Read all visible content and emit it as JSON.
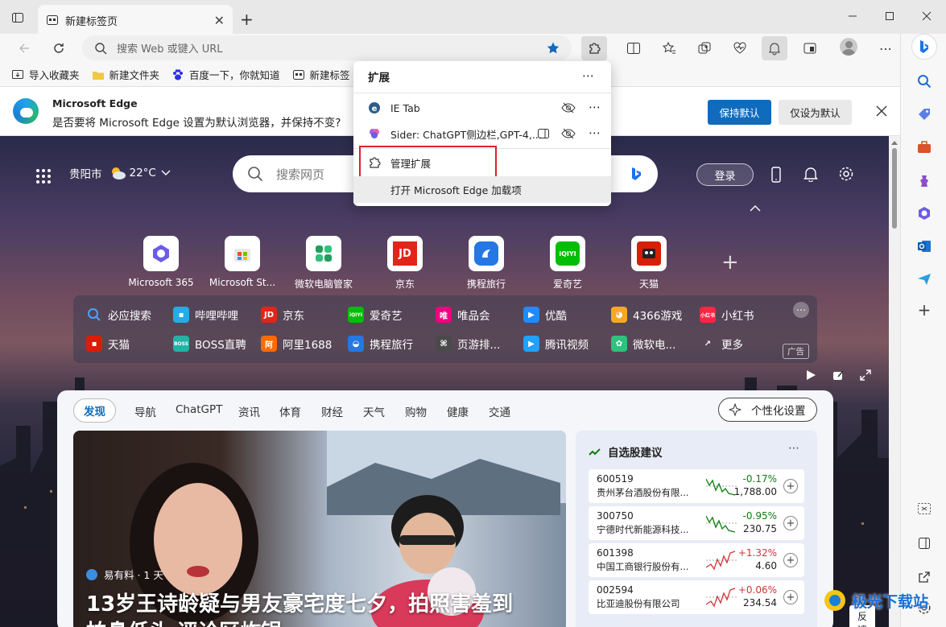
{
  "browser": {
    "tab_title": "新建标签页",
    "address_placeholder": "搜索 Web 或键入 URL"
  },
  "favorites_bar": [
    {
      "label": "导入收藏夹"
    },
    {
      "label": "新建文件夹"
    },
    {
      "label": "百度一下，你就知道"
    },
    {
      "label": "新建标签"
    }
  ],
  "banner": {
    "title": "Microsoft Edge",
    "message": "是否要将 Microsoft Edge 设置为默认浏览器，并保持不变?",
    "keep_default": "保持默认",
    "only_default": "仅设为默认"
  },
  "extensions_popup": {
    "title": "扩展",
    "items": [
      {
        "label": "IE Tab"
      },
      {
        "label": "Sider: ChatGPT侧边栏,GPT-4,..."
      }
    ],
    "manage": "管理扩展",
    "open_addons": "打开 Microsoft Edge 加载项"
  },
  "newtab": {
    "city": "贵阳市",
    "temperature": "22°C",
    "search_placeholder": "搜索网页",
    "login": "登录",
    "tiles": [
      {
        "label": "Microsoft 365"
      },
      {
        "label": "Microsoft St..."
      },
      {
        "label": "微软电脑管家"
      },
      {
        "label": "京东"
      },
      {
        "label": "携程旅行"
      },
      {
        "label": "爱奇艺"
      },
      {
        "label": "天猫"
      }
    ],
    "quick_links_row1": [
      {
        "label": "必应搜索",
        "color": "#1a73e8"
      },
      {
        "label": "哔哩哔哩",
        "color": "#23ade5"
      },
      {
        "label": "京东",
        "color": "#e1251b"
      },
      {
        "label": "爱奇艺",
        "color": "#00be06"
      },
      {
        "label": "唯品会",
        "color": "#f10180"
      },
      {
        "label": "优酷",
        "color": "#1f8bff"
      },
      {
        "label": "4366游戏",
        "color": "#f7a823"
      },
      {
        "label": "小红书",
        "color": "#ff2442"
      }
    ],
    "quick_links_row2": [
      {
        "label": "天猫",
        "color": "#d81e06"
      },
      {
        "label": "BOSS直聘",
        "color": "#21b3a4"
      },
      {
        "label": "阿里1688",
        "color": "#ff6a00"
      },
      {
        "label": "携程旅行",
        "color": "#2577e3"
      },
      {
        "label": "页游排...",
        "color": "#4a4a4a"
      },
      {
        "label": "腾讯视频",
        "color": "#20a0ff"
      },
      {
        "label": "微软电...",
        "color": "#3b7dd8"
      },
      {
        "label": "更多",
        "color": "#888888"
      }
    ],
    "ad_label": "广告",
    "feed_tabs": [
      "发现",
      "导航",
      "ChatGPT",
      "资讯",
      "体育",
      "财经",
      "天气",
      "购物",
      "健康",
      "交通"
    ],
    "personalize": "个性化设置",
    "article": {
      "source": "易有料 · 1 天",
      "headline": "13岁王诗龄疑与男友豪宅度七夕，拍照害羞到",
      "headline_cont": "拍鼻低头 评论区炸锅"
    },
    "stocks_title": "自选股建议",
    "stocks": [
      {
        "code": "600519",
        "name": "贵州茅台酒股份有限...",
        "change": "-0.17%",
        "price": "1,788.00",
        "trend": "down"
      },
      {
        "code": "300750",
        "name": "宁德时代新能源科技...",
        "change": "-0.95%",
        "price": "230.75",
        "trend": "down"
      },
      {
        "code": "601398",
        "name": "中国工商银行股份有...",
        "change": "+1.32%",
        "price": "4.60",
        "trend": "up"
      },
      {
        "code": "002594",
        "name": "比亚迪股份有限公司",
        "change": "+0.06%",
        "price": "234.54",
        "trend": "up"
      }
    ],
    "feedback": "反馈"
  },
  "colors": {
    "accent": "#0f6cbd",
    "highlight_box": "#e0202a",
    "up": "#d13438",
    "down": "#107c10"
  },
  "watermark": "极光下载站"
}
